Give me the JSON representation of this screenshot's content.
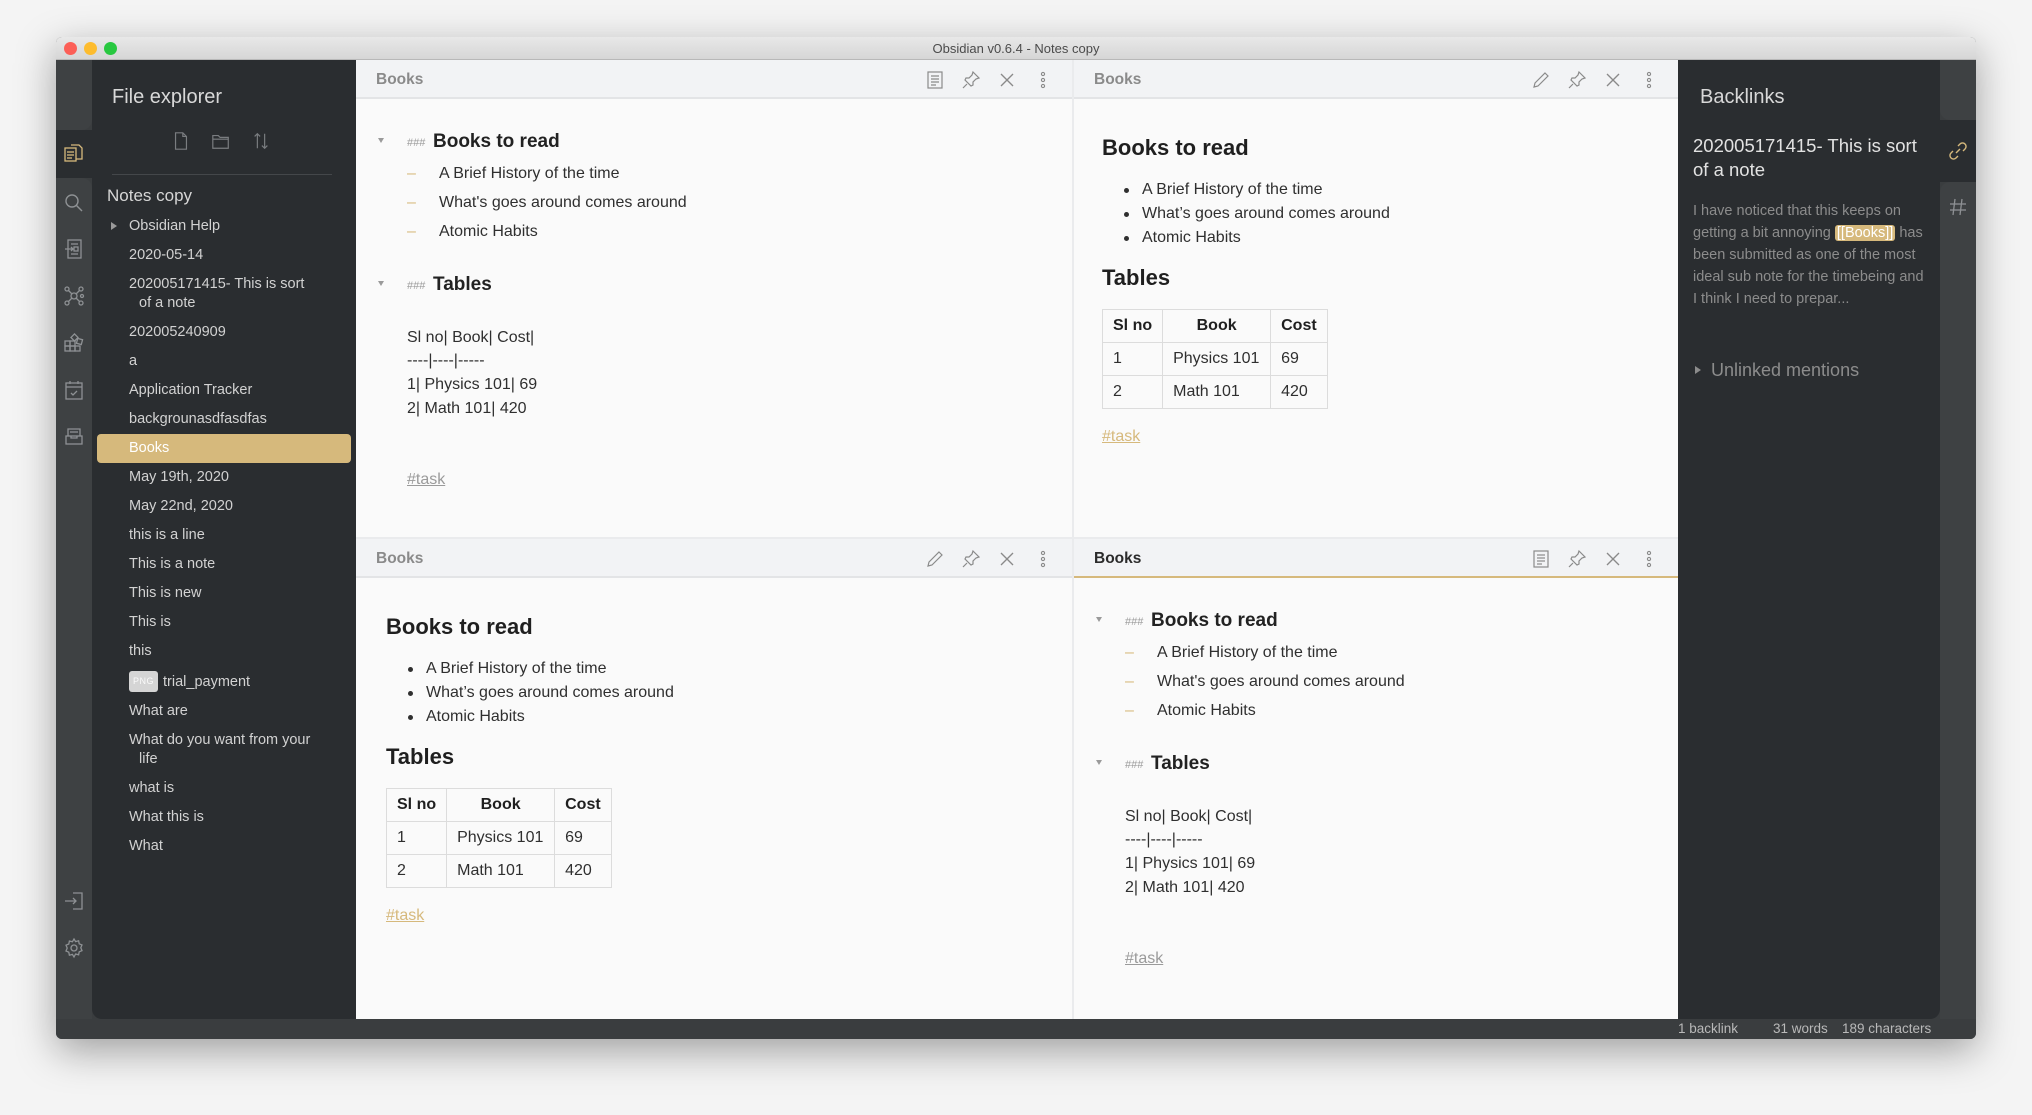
{
  "window": {
    "title": "Obsidian v0.6.4 - Notes copy",
    "accent_color": "#d6b97c"
  },
  "ribbon_left": {
    "icons": [
      "file-explorer-icon",
      "search-icon",
      "import-icon",
      "graph-view-icon",
      "plugins-icon",
      "daily-note-icon",
      "archive-icon"
    ],
    "bottom_icons": [
      "open-vault-icon",
      "settings-icon"
    ]
  },
  "file_explorer": {
    "title": "File explorer",
    "actions": [
      "new-note",
      "new-folder",
      "sort"
    ],
    "vault_name": "Notes copy",
    "items": [
      {
        "label": "Obsidian Help",
        "type": "folder"
      },
      {
        "label": "2020-05-14"
      },
      {
        "label": "202005171415- This is sort",
        "continuation": "of a note"
      },
      {
        "label": "202005240909"
      },
      {
        "label": "a"
      },
      {
        "label": "Application Tracker"
      },
      {
        "label": "backgrounasdfasdfas"
      },
      {
        "label": "Books",
        "active": true
      },
      {
        "label": "May 19th, 2020"
      },
      {
        "label": "May 22nd, 2020"
      },
      {
        "label": "this is a line"
      },
      {
        "label": "This is a note"
      },
      {
        "label": "This is new"
      },
      {
        "label": "This is"
      },
      {
        "label": "this"
      },
      {
        "label": "trial_payment",
        "badge": "PNG"
      },
      {
        "label": "What are"
      },
      {
        "label": "What do you want from your",
        "continuation": "life"
      },
      {
        "label": "what is"
      },
      {
        "label": "What this is"
      },
      {
        "label": "What"
      }
    ]
  },
  "note": {
    "title": "Books",
    "heading1": "Books to read",
    "heading_marker": "###",
    "books": [
      "A Brief History of the time",
      "What's goes around comes around",
      "Atomic Habits"
    ],
    "books_preview": [
      "A Brief History of the time",
      "What’s goes around comes around",
      "Atomic Habits"
    ],
    "heading2": "Tables",
    "raw_table": [
      "Sl no| Book| Cost|",
      "----|----|-----",
      "1| Physics 101| 69",
      "2| Math 101| 420"
    ],
    "table": {
      "headers": [
        "Sl no",
        "Book",
        "Cost"
      ],
      "rows": [
        [
          "1",
          "Physics 101",
          "69"
        ],
        [
          "2",
          "Math 101",
          "420"
        ]
      ]
    },
    "tag": "#task"
  },
  "panes": [
    {
      "position": "top-left",
      "mode": "edit",
      "mode_toggle_icon": "preview-icon",
      "active": false
    },
    {
      "position": "top-right",
      "mode": "preview",
      "mode_toggle_icon": "edit-pencil-icon",
      "active": false
    },
    {
      "position": "bottom-left",
      "mode": "preview",
      "mode_toggle_icon": "edit-pencil-icon",
      "active": false
    },
    {
      "position": "bottom-right",
      "mode": "edit",
      "mode_toggle_icon": "preview-icon",
      "active": true
    }
  ],
  "backlinks": {
    "title": "Backlinks",
    "file": "202005171415- This is sort of a note",
    "snippet_before": "I have noticed that this keeps on getting a bit annoying ",
    "snippet_link": "[[Books]]",
    "snippet_after": " has been submitted as one of the most ideal sub note for the timebeing and I think I need to prepar...",
    "unlinked_label": "Unlinked mentions"
  },
  "ribbon_right": {
    "icons": [
      "backlinks-icon",
      "tags-icon"
    ]
  },
  "statusbar": {
    "backlinks": "1 backlink",
    "words": "31 words",
    "characters": "189 characters"
  }
}
